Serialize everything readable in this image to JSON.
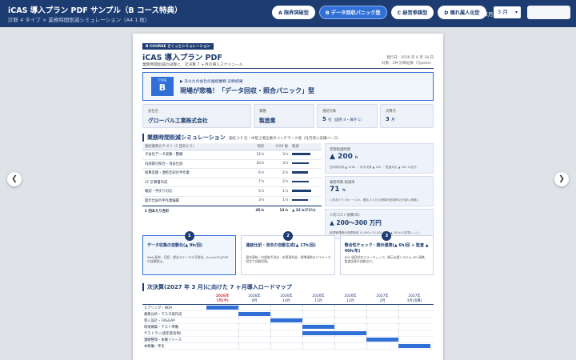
{
  "app": {
    "title": "iCAS 導入プラン PDF サンプル（B コース特典）",
    "subtitle": "診断 4 タイプ × 業務時間削減シミュレーション（A4 1 枚）"
  },
  "tabs": [
    {
      "label": "A 限界突破型",
      "active": false
    },
    {
      "label": "B データ回収パニック型",
      "active": true
    },
    {
      "label": "C 経営参謀型",
      "active": false
    },
    {
      "label": "D 隠れ属人化型",
      "active": false
    }
  ],
  "month_select": {
    "label": "決算月",
    "value": "3 月"
  },
  "pdf_button": {
    "label": ""
  },
  "nav": {
    "prev_icon": "chevron-left-icon",
    "next_icon": "chevron-right-icon"
  },
  "doc": {
    "course_tag": "B COURSE さくっとシミュレーション",
    "title": "iCAS 導入プラン PDF",
    "subtitle": "業務時間削減の試算と、次決算 7 ヶ月の導入スケジュール",
    "meta_date": "発行日：2026 年 6 月 18 日",
    "meta_to": "対象：ZM 診断結果（Typebe）",
    "diagnosis": {
      "type_label": "TYPE",
      "type_letter": "B",
      "small": "▶ あなたの会社の連結業務 診断結果",
      "main": "現場が悲鳴！「データ回収・照合パニック」型"
    },
    "info": [
      {
        "label": "会社名",
        "value": "グローバル工業株式会社",
        "note": ""
      },
      {
        "label": "業種",
        "value": "製造業",
        "note": ""
      },
      {
        "label": "連結対象",
        "value": "5",
        "note": "社（国内 4・海外 1）"
      },
      {
        "label": "決算月",
        "value": "3",
        "note": "月"
      }
    ],
    "sim": {
      "title": "業務時間削減シミュレーション",
      "note": "連結 3-5 社・中堅上場企業のベンチマーク値（社内導入実績ベース）",
      "headers": {
        "name": "連結業務カテゴリ（1 回あたり）",
        "current": "現状",
        "after": "iCAS 後",
        "reduction": "削減"
      },
      "rows": [
        {
          "name": "子会社データ収集・整備",
          "current": "12 h",
          "after": "3 h",
          "pct": 75
        },
        {
          "name": "内部取引照合・消去仕訳",
          "current": "10 h",
          "after": "3 h",
          "pct": 70
        },
        {
          "name": "換算差額・連結仕訳の手作業",
          "current": "6 h",
          "after": "2 h",
          "pct": 67
        },
        {
          "name": "CF 計算書作成",
          "current": "7 h",
          "after": "2 h",
          "pct": 71
        },
        {
          "name": "確認・手戻り対応",
          "current": "5 h",
          "after": "1 h",
          "pct": 80
        },
        {
          "name": "開示仕訳の手作業編纂",
          "current": "3 h",
          "after": "1 h",
          "pct": 67
        }
      ],
      "total": {
        "name": "1 回あたり合計",
        "current": "45 h",
        "after": "13 h",
        "reduction": "▲ 32 h(71%)"
      }
    },
    "kpis": [
      {
        "label": "年間削減時間",
        "value": "▲ 200",
        "unit": "h",
        "note": "四半期決算 ▲ 128h ／ 年次決算 ▲ 32h ／ 監査対応 ▲ 40h の合計。"
      },
      {
        "label": "業務時間 削減率",
        "value": "71",
        "unit": "%",
        "note": "1 回あたり 45h → 13h。連結 3-5 社の標準的削減率(社内導入実績)。"
      },
      {
        "label": "人的コスト換算(年)",
        "value": "▲ 200〜300 万円",
        "unit": "",
        "note": "経理管理職の時間単価 10,000〜15,000 円 × ▲ 200h の試算レンジ。"
      }
    ],
    "steps": [
      {
        "num": "1",
        "title": "データ収集の自動化(▲ 9h/回)",
        "desc": "Web 配布・回収・提出ステータス可視化。Excel/CSV/PDF の自動取込。",
        "active": true
      },
      {
        "num": "2",
        "title": "連結仕訳・消去の自動生成(▲ 17h/回)",
        "desc": "資本連結・内部取引消去・未実現利益・標準連結をパラメータ設定で自動処理。",
        "active": false
      },
      {
        "num": "3",
        "title": "整合性チェック・開示連携(▲ 6h/回 + 監査 ▲ 40h/年)",
        "desc": "600 項目超のエラーチェック。開示支援システム API 連携、監査証跡の自動出力。",
        "active": false
      }
    ],
    "roadmap": {
      "title": "次決算(2027 年 3 月)に向けた 7 ヶ月導入ロードマップ",
      "months": [
        {
          "year": "2026年",
          "month": "7月(今)",
          "highlight": true
        },
        {
          "year": "2026年",
          "month": "9月",
          "highlight": false
        },
        {
          "year": "2026年",
          "month": "10月",
          "highlight": false
        },
        {
          "year": "2026年",
          "month": "11月",
          "highlight": false
        },
        {
          "year": "2026年",
          "month": "12月",
          "highlight": false
        },
        {
          "year": "2027年",
          "month": "2月",
          "highlight": false
        },
        {
          "year": "2027年",
          "month": "3月(決算)",
          "highlight": false
        }
      ],
      "tasks": [
        {
          "name": "ヒアリング・NDA",
          "start": 0,
          "end": 1
        },
        {
          "name": "業務分析・マスタ案作成",
          "start": 1,
          "end": 2
        },
        {
          "name": "導入設計・Fit&GAP",
          "start": 2,
          "end": 3
        },
        {
          "name": "環境構築・テスト準備",
          "start": 3,
          "end": 4
        },
        {
          "name": "テストラン(過年度再現)",
          "start": 3,
          "end": 5
        },
        {
          "name": "課題整理・本番リリース",
          "start": 5,
          "end": 6
        },
        {
          "name": "本稼働・伴走",
          "start": 6,
          "end": 7
        }
      ]
    }
  }
}
